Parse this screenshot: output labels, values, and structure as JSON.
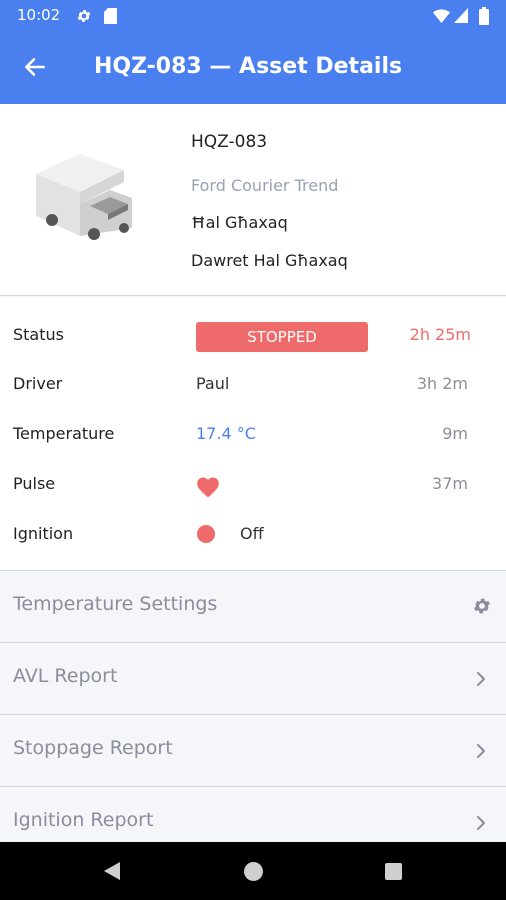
{
  "status_bar": {
    "time": "10:02"
  },
  "app_bar": {
    "title": "HQZ-083 — Asset Details"
  },
  "asset": {
    "code": "HQZ-083",
    "model": "Ford Courier Trend",
    "location_line1": "Ħal Għaxaq",
    "location_line2": "Dawret Hal Għaxaq"
  },
  "details": {
    "status": {
      "label": "Status",
      "value": "STOPPED",
      "time": "2h 25m"
    },
    "driver": {
      "label": "Driver",
      "value": "Paul",
      "time": "3h 2m"
    },
    "temperature": {
      "label": "Temperature",
      "value": "17.4 °C",
      "time": "9m"
    },
    "pulse": {
      "label": "Pulse",
      "icon": "heart-icon",
      "time": "37m"
    },
    "ignition": {
      "label": "Ignition",
      "value": "Off"
    }
  },
  "menu": [
    {
      "label": "Temperature Settings",
      "icon": "gear-icon"
    },
    {
      "label": "AVL Report",
      "icon": "chevron-right-icon"
    },
    {
      "label": "Stoppage Report",
      "icon": "chevron-right-icon"
    },
    {
      "label": "Ignition Report",
      "icon": "chevron-right-icon"
    }
  ],
  "colors": {
    "primary": "#4a7ff0",
    "alert": "#ef6b6b",
    "muted": "#8a8e9c"
  }
}
